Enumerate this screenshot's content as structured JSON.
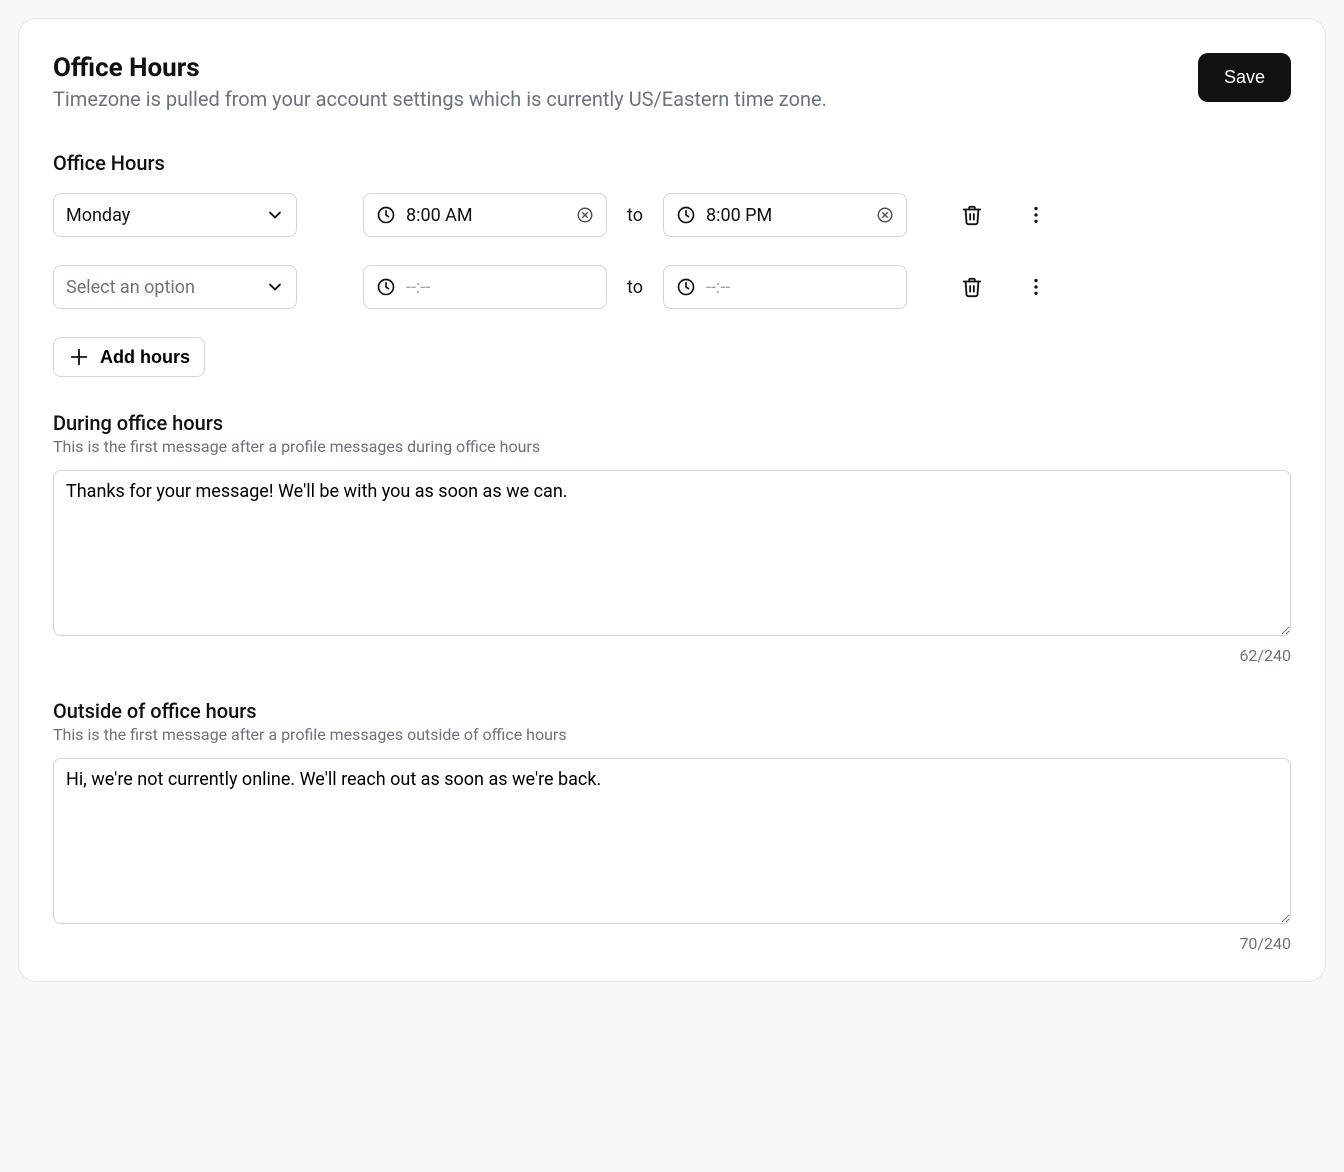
{
  "header": {
    "title": "Office Hours",
    "subtitle": "Timezone is pulled from your account settings which is currently US/Eastern time zone.",
    "save_label": "Save"
  },
  "hours_section": {
    "label": "Office Hours",
    "to_label": "to",
    "add_hours_label": "Add hours",
    "rows": [
      {
        "day": "Monday",
        "day_placeholder": "Select an option",
        "start": "8:00 AM",
        "end": "8:00 PM",
        "time_placeholder": "--:--"
      },
      {
        "day": "",
        "day_placeholder": "Select an option",
        "start": "",
        "end": "",
        "time_placeholder": "--:--"
      }
    ]
  },
  "during": {
    "label": "During office hours",
    "help": "This is the first message after a profile messages during office hours",
    "value": "Thanks for your message! We'll be with you as soon as we can.",
    "counter": "62/240"
  },
  "outside": {
    "label": "Outside of office hours",
    "help": "This is the first message after a profile messages outside of office hours",
    "value": "Hi, we're not currently online. We'll reach out as soon as we're back.",
    "counter": "70/240"
  }
}
